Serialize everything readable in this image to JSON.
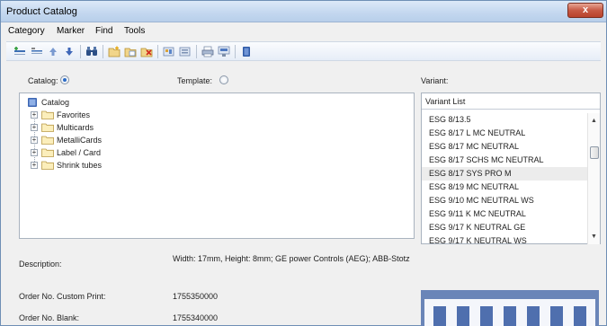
{
  "window": {
    "title": "Product Catalog",
    "close_glyph": "x"
  },
  "menu": [
    "Category",
    "Marker",
    "Find",
    "Tools"
  ],
  "toolbar": {
    "icons": [
      "add-row-icon",
      "remove-row-icon",
      "move-up-icon",
      "move-down-icon",
      "binoculars-icon",
      "new-catalog-icon",
      "copy-catalog-icon",
      "delete-catalog-icon",
      "import-icon",
      "export-icon",
      "print-icon",
      "settings-icon",
      "book-icon"
    ]
  },
  "source": {
    "catalog_label": "Catalog:",
    "template_label": "Template:",
    "selected": "catalog"
  },
  "tree": {
    "root": "Catalog",
    "children": [
      "Favorites",
      "Multicards",
      "MetalliCards",
      "Label / Card",
      "Shrink tubes"
    ]
  },
  "variant": {
    "label": "Variant:",
    "list_header": "Variant List",
    "items": [
      "ESG 8/13.5",
      "ESG 8/17 L MC NEUTRAL",
      "ESG 8/17 MC NEUTRAL",
      "ESG 8/17 SCHS MC NEUTRAL",
      "ESG 8/17 SYS PRO M",
      "ESG 8/19 MC NEUTRAL",
      "ESG 9/10 MC NEUTRAL WS",
      "ESG 9/11 K MC NEUTRAL",
      "ESG 9/17 K NEUTRAL GE",
      "ESG 9/17 K NEUTRAL WS"
    ],
    "selected_index": 4
  },
  "details": {
    "description_label": "Description:",
    "description_value": "Width: 17mm, Height: 8mm; GE power Controls (AEG); ABB-Stotz",
    "order_custom_label": "Order No. Custom Print:",
    "order_custom_value": "1755350000",
    "order_blank_label": "Order No. Blank:",
    "order_blank_value": "1755340000"
  },
  "colors": {
    "accent": "#2b6bc6",
    "close": "#c75a45",
    "preview_bg": "#6a85b8"
  }
}
